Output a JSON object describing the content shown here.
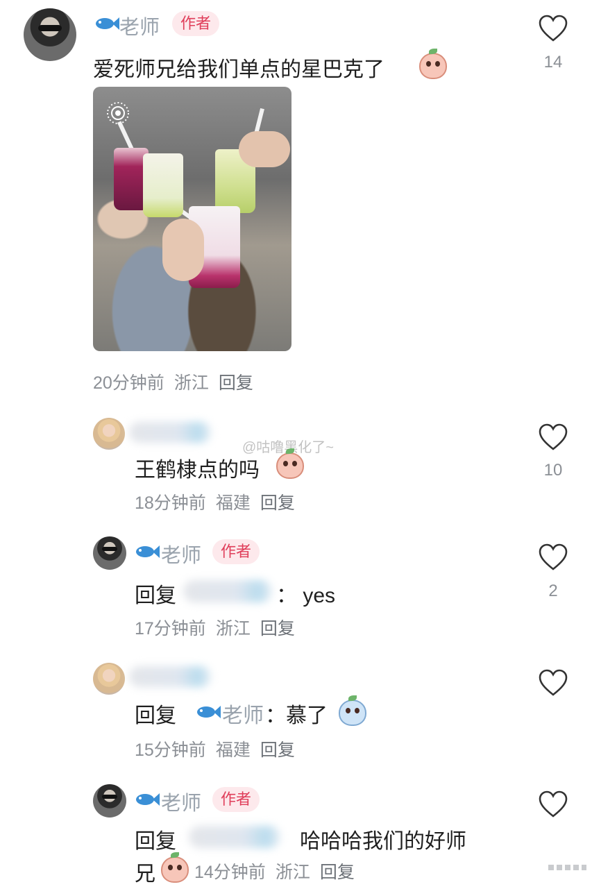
{
  "comments": [
    {
      "name": "老师",
      "badge": "作者",
      "text": "爱死师兄给我们单点的星巴克了",
      "time": "20分钟前",
      "location": "浙江",
      "reply_label": "回复",
      "likes": "14"
    },
    {
      "text": "王鹤棣点的吗",
      "time": "18分钟前",
      "location": "福建",
      "reply_label": "回复",
      "likes": "10"
    },
    {
      "name": "老师",
      "badge": "作者",
      "reply_prefix": "回复",
      "text": "：  yes",
      "time": "17分钟前",
      "location": "浙江",
      "reply_label": "回复",
      "likes": "2"
    },
    {
      "reply_prefix": "回复",
      "mention": "老师",
      "text": "：慕了",
      "time": "15分钟前",
      "location": "福建",
      "reply_label": "回复"
    },
    {
      "name": "老师",
      "badge": "作者",
      "reply_prefix": "回复",
      "text": "哈哈哈我们的好师",
      "text_line2": "兄",
      "time": "14分钟前",
      "location": "浙江",
      "reply_label": "回复"
    }
  ],
  "watermark": "@咕噜黑化了~",
  "colors": {
    "badge_bg": "#fde9ec",
    "badge_text": "#e03e5a",
    "meta_text": "#8b8f95",
    "fish_blue": "#3a8fd6"
  }
}
